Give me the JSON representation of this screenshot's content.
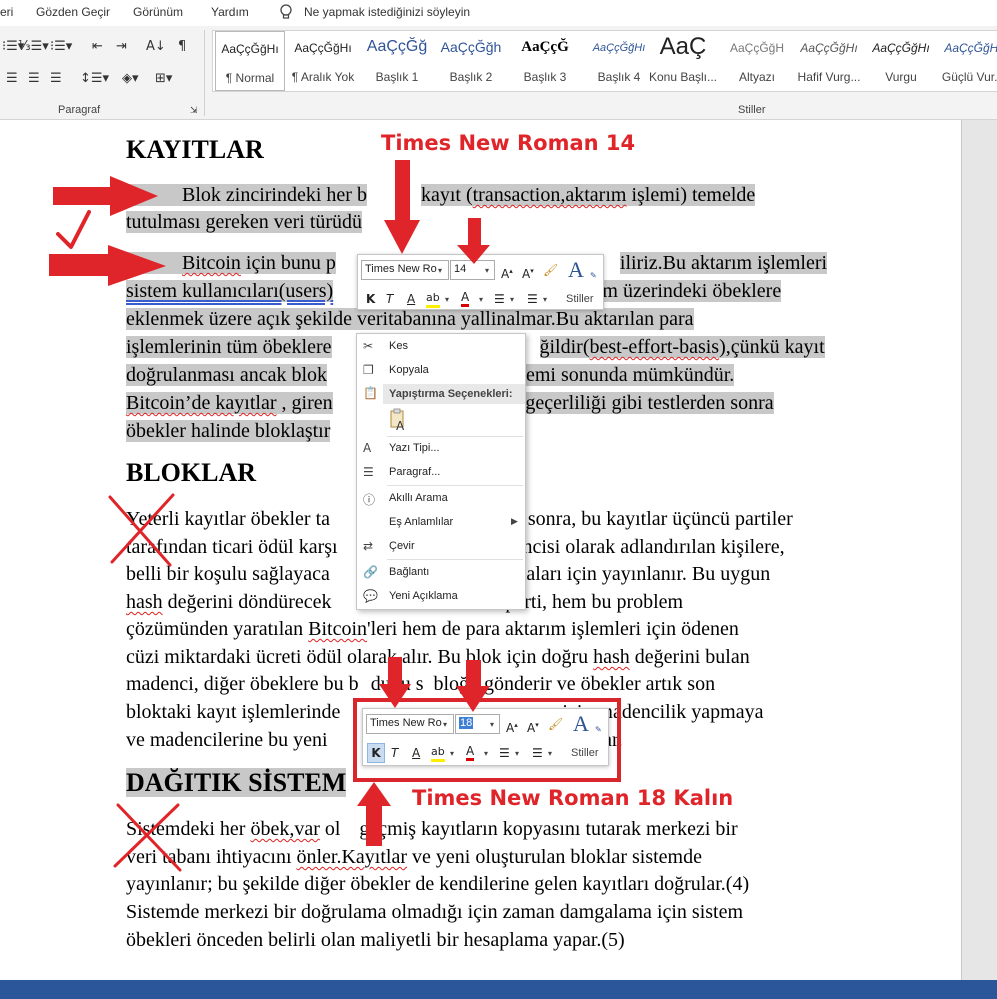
{
  "menu": [
    "eri",
    "Gözden Geçir",
    "Görünüm",
    "Yardım",
    "Ne yapmak istediğinizi söyleyin"
  ],
  "ribbon": {
    "paragraph_label": "Paragraf",
    "styles_label": "Stiller",
    "styles": [
      {
        "preview": "AaÇçĞğHı",
        "name": "¶ Normal"
      },
      {
        "preview": "AaÇçĞğHı",
        "name": "¶ Aralık Yok"
      },
      {
        "preview": "AaÇçĞğ",
        "name": "Başlık 1"
      },
      {
        "preview": "AaÇçĞğh",
        "name": "Başlık 2"
      },
      {
        "preview": "AaÇçĞ",
        "name": "Başlık 3"
      },
      {
        "preview": "AaÇçĞğHı",
        "name": "Başlık 4"
      },
      {
        "preview": "AaÇ",
        "name": "Konu Başlı..."
      },
      {
        "preview": "AaÇçĞğH",
        "name": "Altyazı"
      },
      {
        "preview": "AaÇçĞğHı",
        "name": "Hafif Vurg..."
      },
      {
        "preview": "AaÇçĞğHı",
        "name": "Vurgu"
      },
      {
        "preview": "AaÇçĞğHı",
        "name": "Güçlü Vur..."
      }
    ]
  },
  "doc": {
    "h1": "KAYITLAR",
    "h2": "BLOKLAR",
    "h3": "DAĞITIK SİSTEM",
    "p1": {
      "l1a": "Blok zincirindeki her b",
      "l1b": "kayıt (",
      "l1c": "transaction,aktarım",
      "l1d": " işlemi) temelde",
      "l2": "tutulması gereken veri türüdü"
    },
    "p2": {
      "l1a": "Bitcoin",
      "l1b": " için bunu p",
      "l1c": "iliriz.Bu aktarım işlemleri",
      "l2a": "sistem kullanıcıları(users)",
      "l2b": "stem üzerindeki öbeklere",
      "l3a": "eklenmek üzere açık şekild",
      "l3b": "e veritabanına yallinalmar.Bu  aktarılan para",
      "l4a": "işlemlerinin tüm öbeklere",
      "l4b": "ğildir(",
      "l4c": "best-effort-basis",
      "l4d": "),çünkü kayıt",
      "l5a": "doğrulanması ancak blok",
      "l5b": " işlemi sonunda mümkündür.",
      "l6a": "Bitcoin’de  kayıtlar",
      "l6b": " , giren",
      "l6c": "nza geçerliliği gibi testlerden sonra",
      "l7": "öbekler halinde bloklaştır"
    },
    "p3": {
      "l1a": "Yeterli kayıtlar öbekler ta",
      "l1b": "an sonra, bu kayıtlar üçüncü partiler",
      "l2a": "tarafından ticari ödül karşı",
      "l2b": "dencisi olarak adlandırılan kişilere,",
      "l3a": "belli bir koşulu sağlayaca",
      "l3b": "maları için yayınlanır. Bu uygun",
      "l4a": "hash",
      "l4b": " değerini döndürecek",
      "l4c": "ebilen parti, hem bu problem",
      "l5a": "çözümünden yaratılan ",
      "l5b": "Bitcoin",
      "l5c": "'leri hem de para aktarım işlemleri için ödenen",
      "l6a": "cüzi miktardaki ücreti ödül olarak alır. Bu blok için doğru ",
      "l6b": "hash",
      "l6c": " değerini bulan",
      "l7a": "madenci, diğer öbeklere bu b",
      "l7b": "duğu s",
      "l7c": "bloğu gönderir ve öbekler artık son",
      "l8a": "bloktaki kayıt işlemlerinde",
      "l8b": "için madencilik yapmaya",
      "l9a": "ve madencilerine bu yeni",
      "l9b": "lar."
    },
    "p4": {
      "l1a": "Sistemdeki her ",
      "l1b": "öbek,var",
      "l1c": " ol",
      "l1d": " geçmiş kayıtların kopyasını tutarak merkezi bir",
      "l2a": "veri tabanı ihtiyacını ",
      "l2b": "önler.Kayıtlar",
      "l2c": " ve yeni oluşturulan bloklar sistemde",
      "l3": "yayınlanır; bu şekilde diğer öbekler de kendilerine gelen kayıtları doğrular.(4)",
      "l4": "Sistemde merkezi bir doğrulama olmadığı için zaman damgalama için sistem",
      "l5": "öbekleri önceden belirli olan maliyetli bir hesaplama yapar.(5)"
    }
  },
  "mini1": {
    "font": "Times New Ro",
    "size": "14",
    "stiller": "Stiller"
  },
  "mini2": {
    "font": "Times New Ro",
    "size": "18",
    "stiller": "Stiller"
  },
  "context_menu": {
    "items": [
      "Kes",
      "Kopyala",
      "Yazı Tipi...",
      "Paragraf...",
      "Akıllı Arama",
      "Eş Anlamlılar",
      "Çevir",
      "Bağlantı",
      "Yeni Açıklama"
    ],
    "paste_section": "Yapıştırma Seçenekleri:"
  },
  "annotations": {
    "top": "Times New Roman      14",
    "bottom": "Times New Roman 18 Kalın"
  },
  "colors": {
    "annotation": "#e0252a",
    "statusbar": "#2b579a",
    "highlight": "#c8c8c8"
  }
}
